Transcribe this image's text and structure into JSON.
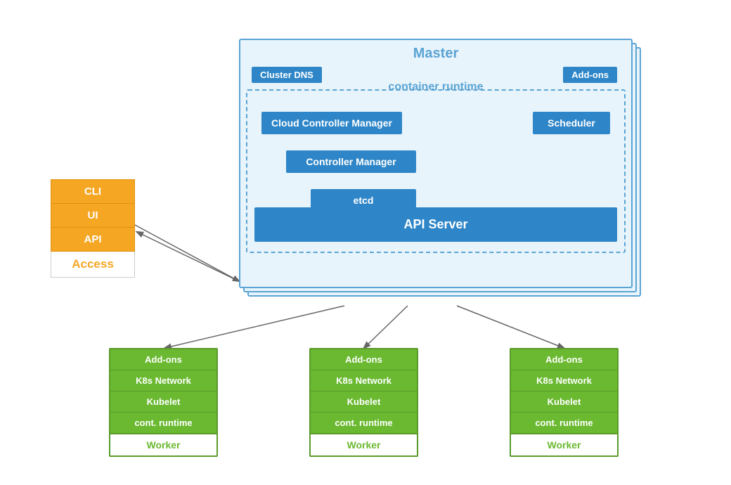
{
  "access": {
    "cli": "CLI",
    "ui": "UI",
    "api": "API",
    "label": "Access"
  },
  "master": {
    "title": "Master",
    "cluster_dns": "Cluster DNS",
    "addons_top": "Add-ons",
    "container_runtime": "container runtime",
    "cloud_controller": "Cloud Controller Manager",
    "scheduler": "Scheduler",
    "controller_manager": "Controller Manager",
    "etcd": "etcd",
    "api_server": "API Server"
  },
  "workers": [
    {
      "addons": "Add-ons",
      "network": "K8s Network",
      "kubelet": "Kubelet",
      "runtime": "cont. runtime",
      "label": "Worker"
    },
    {
      "addons": "Add-ons",
      "network": "K8s Network",
      "kubelet": "Kubelet",
      "runtime": "cont. runtime",
      "label": "Worker"
    },
    {
      "addons": "Add-ons",
      "network": "K8s Network",
      "kubelet": "Kubelet",
      "runtime": "cont. runtime",
      "label": "Worker"
    }
  ]
}
